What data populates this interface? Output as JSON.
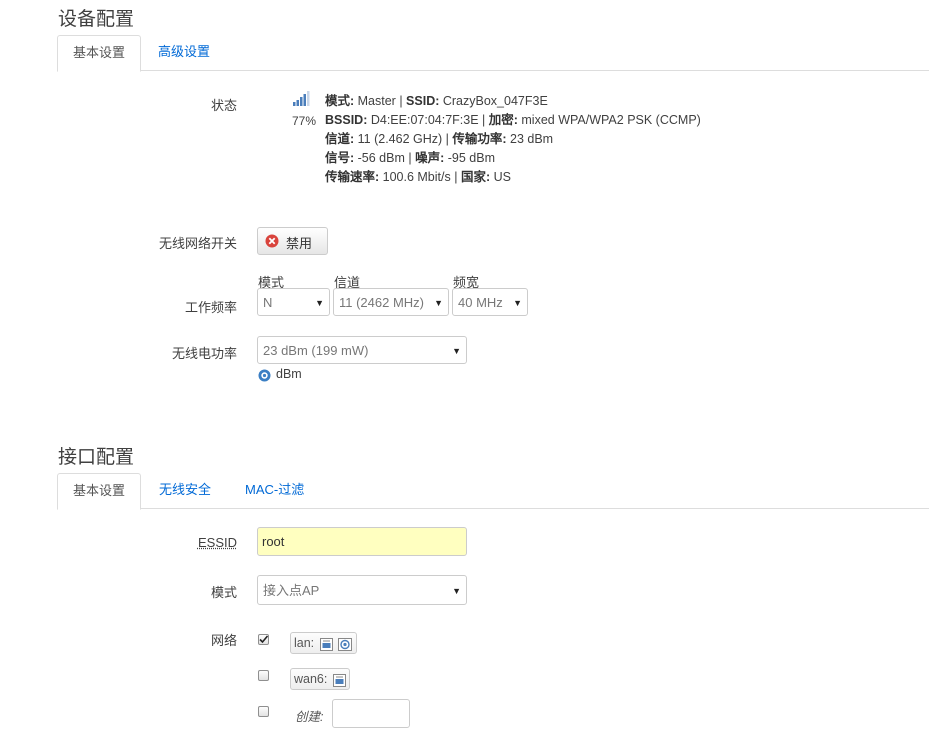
{
  "device_config": {
    "title": "设备配置",
    "tabs": [
      {
        "label": "基本设置",
        "active": true
      },
      {
        "label": "高级设置",
        "active": false
      }
    ],
    "status": {
      "label": "状态",
      "signal_percent": "77%",
      "line1": {
        "k1": "模式:",
        "v1": " Master | ",
        "k2": "SSID:",
        "v2": " CrazyBox_047F3E"
      },
      "line2": {
        "k1": "BSSID:",
        "v1": " D4:EE:07:04:7F:3E | ",
        "k2": "加密:",
        "v2": " mixed WPA/WPA2 PSK (CCMP)"
      },
      "line3": {
        "k1": "信道:",
        "v1": " 11 (2.462 GHz) | ",
        "k2": "传输功率:",
        "v2": " 23 dBm"
      },
      "line4": {
        "k1": "信号:",
        "v1": " -56 dBm | ",
        "k2": "噪声:",
        "v2": " -95 dBm"
      },
      "line5": {
        "k1": "传输速率:",
        "v1": " 100.6 Mbit/s | ",
        "k2": "国家:",
        "v2": " US"
      }
    },
    "wireless_switch": {
      "label": "无线网络开关",
      "button": "禁用"
    },
    "work_freq": {
      "label": "工作频率",
      "mode": {
        "label": "模式",
        "value": "N"
      },
      "channel": {
        "label": "信道",
        "value": "11 (2462 MHz)"
      },
      "width": {
        "label": "频宽",
        "value": "40 MHz"
      }
    },
    "tx_power": {
      "label": "无线电功率",
      "value": "23 dBm (199 mW)",
      "hint": "dBm"
    }
  },
  "interface_config": {
    "title": "接口配置",
    "tabs": [
      {
        "label": "基本设置",
        "active": true
      },
      {
        "label": "无线安全",
        "active": false
      },
      {
        "label": "MAC-过滤",
        "active": false
      }
    ],
    "essid": {
      "label": "ESSID",
      "value": "root"
    },
    "mode": {
      "label": "模式",
      "value": "接入点AP"
    },
    "network": {
      "label": "网络",
      "items": [
        {
          "name": "lan:",
          "checked": true
        },
        {
          "name": "wan6:",
          "checked": false
        }
      ],
      "create_label": "创建:",
      "create_value": ""
    }
  },
  "colors": {
    "accent": "#0069d6",
    "essid_bg": "#ffffc0",
    "signal": "#4a7ebb"
  }
}
